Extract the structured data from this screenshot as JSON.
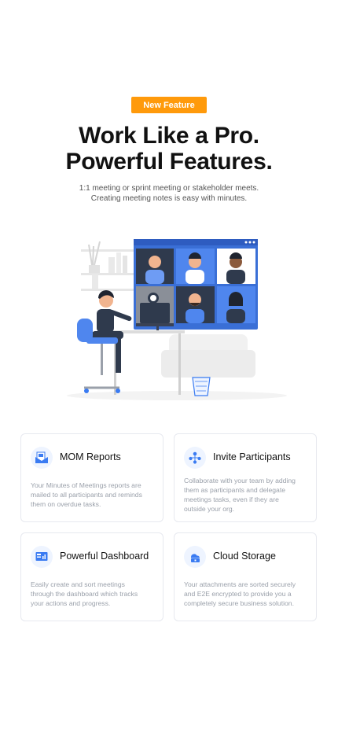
{
  "hero": {
    "badge": "New Feature",
    "title_line1": "Work Like a Pro.",
    "title_line2": "Powerful Features.",
    "subtitle_line1": "1:1 meeting or sprint meeting or stakeholder meets.",
    "subtitle_line2": "Creating meeting notes is easy with minutes."
  },
  "colors": {
    "accent": "#ff9a0b",
    "primary": "#3a7bf2",
    "card_border": "#e7e9ef"
  },
  "features": [
    {
      "title": "MOM Reports",
      "icon": "mail-report-icon",
      "desc_lines": [
        "Your Minutes of Meetings reports are",
        "mailed to all participants and reminds",
        "them on overdue tasks."
      ]
    },
    {
      "title": "Invite Participants",
      "icon": "people-network-icon",
      "desc_lines": [
        "Collaborate with your team by adding",
        "them as participants and delegate",
        "meetings tasks, even if they are",
        "outside your org."
      ]
    },
    {
      "title": "Powerful Dashboard",
      "icon": "dashboard-icon",
      "desc_lines": [
        "Easily create and sort meetings",
        "through the dashboard which tracks",
        "your actions and progress."
      ]
    },
    {
      "title": "Cloud Storage",
      "icon": "cloud-storage-icon",
      "desc_lines": [
        "Your attachments are sorted securely",
        "and E2E encrypted to provide you a",
        "completely secure business solution."
      ]
    }
  ]
}
